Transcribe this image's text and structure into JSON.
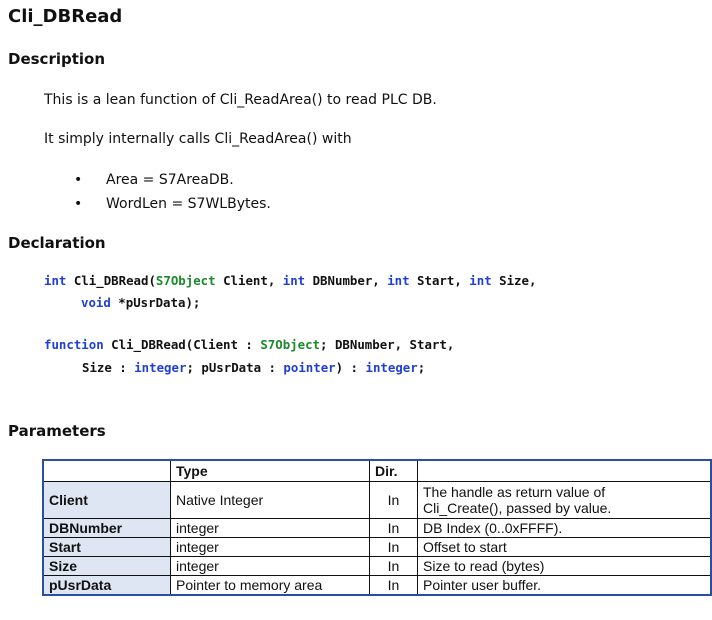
{
  "doc": {
    "title": "Cli_DBRead",
    "description_heading": "Description",
    "desc_line1": "This is a lean function of Cli_ReadArea() to read PLC DB.",
    "desc_line2": "It simply internally calls Cli_ReadArea() with",
    "bullets": [
      "Area = S7AreaDB.",
      "WordLen = S7WLBytes."
    ],
    "declaration_heading": "Declaration",
    "parameters_heading": "Parameters"
  },
  "code": {
    "c": {
      "kw_int1": "int",
      "fn": " Cli_DBRead(",
      "type1": "S7Object",
      "p1": " Client, ",
      "kw_int2": "int",
      "p2": " DBNumber, ",
      "kw_int3": "int",
      "p3": " Start, ",
      "kw_int4": "int",
      "p4": " Size,",
      "kw_void": "void",
      "p5": " *pUsrData);"
    },
    "pascal": {
      "kw_function": "function",
      "l1": " Cli_DBRead(Client : ",
      "type1": "S7Object",
      "l1b": "; DBNumber, Start,",
      "l2a": "Size : ",
      "kw_integer1": "integer",
      "l2b": "; pUsrData : ",
      "kw_pointer": "pointer",
      "l2c": ") : ",
      "kw_integer2": "integer",
      "l2d": ";"
    }
  },
  "table": {
    "headers": [
      "",
      "Type",
      "Dir.",
      ""
    ],
    "rows": [
      {
        "name": "Client",
        "type": "Native Integer",
        "dir": "In",
        "desc_line1": "The handle as return value of",
        "desc_line2": "Cli_Create(), passed by value."
      },
      {
        "name": "DBNumber",
        "type": "integer",
        "dir": "In",
        "desc": "DB Index (0..0xFFFF)."
      },
      {
        "name": "Start",
        "type": "integer",
        "dir": "In",
        "desc": "Offset to start"
      },
      {
        "name": "Size",
        "type": "integer",
        "dir": "In",
        "desc": "Size to read (bytes)"
      },
      {
        "name": "pUsrData",
        "type": "Pointer to memory area",
        "dir": "In",
        "desc": "Pointer user buffer."
      }
    ]
  },
  "colors": {
    "keyword": "#1f3fd6",
    "type": "#1a8a2a",
    "table_border": "#2b4fa0",
    "name_cell_bg": "#dfe6f3"
  }
}
